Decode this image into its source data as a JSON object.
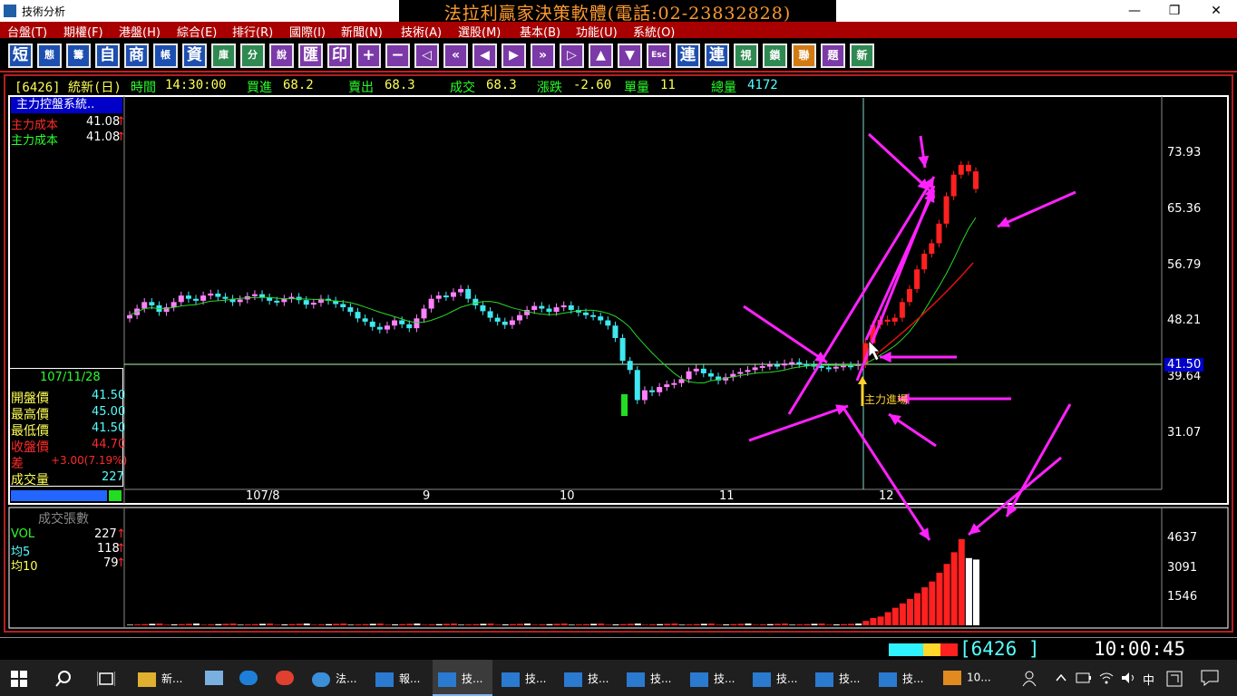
{
  "window": {
    "title": "技術分析",
    "banner": "法拉利贏家決策軟體(電話:02-23832828)"
  },
  "window_controls": {
    "minimize": "—",
    "maximize": "❐",
    "close": "✕"
  },
  "menu": [
    "台盤(T)",
    "期權(F)",
    "港盤(H)",
    "綜合(E)",
    "排行(R)",
    "國際(I)",
    "新聞(N)",
    "技術(A)",
    "選股(M)",
    "基本(B)",
    "功能(U)",
    "系統(O)"
  ],
  "toolbar": [
    "短",
    "態",
    "籌",
    "自",
    "商",
    "帳",
    "資",
    "庫",
    "分",
    "說",
    "匯",
    "印",
    "+",
    "−",
    "◁",
    "«",
    "◀",
    "▶",
    "»",
    "▷",
    "▲",
    "▼",
    "Esc",
    "連",
    "連",
    "視",
    "鎖",
    "聯",
    "題",
    "新"
  ],
  "quote": {
    "symbol": "[6426] 統新(日)",
    "time_label": "時間",
    "time": "14:30:00",
    "bid_label": "買進",
    "bid": "68.2",
    "ask_label": "賣出",
    "ask": "68.3",
    "deal_label": "成交",
    "deal": "68.3",
    "change_label": "漲跌",
    "change": "-2.60",
    "unit_label": "單量",
    "unit": "11",
    "total_label": "總量",
    "total": "4172"
  },
  "indicator_panel": {
    "title": "主力控盤系統..",
    "rows": [
      {
        "label": "主力成本",
        "value": "41.08",
        "arrow": "↑",
        "color": "#ff2a2a"
      },
      {
        "label": "主力成本",
        "value": "41.08",
        "arrow": "↑",
        "color": "#2aff2a"
      }
    ]
  },
  "day_info": {
    "date": "107/11/28",
    "rows": [
      {
        "label": "開盤價",
        "value": "41.50",
        "lcolor": "#ffff55",
        "vcolor": "#55ffff"
      },
      {
        "label": "最高價",
        "value": "45.00",
        "lcolor": "#ffff55",
        "vcolor": "#55ffff"
      },
      {
        "label": "最低價",
        "value": "41.50",
        "lcolor": "#ffff55",
        "vcolor": "#55ffff"
      },
      {
        "label": "收盤價",
        "value": "44.70",
        "lcolor": "#ff2a2a",
        "vcolor": "#ff2a2a"
      },
      {
        "label": "差",
        "value": "+3.00(7.19%)",
        "lcolor": "#ff2a2a",
        "vcolor": "#ff2a2a"
      },
      {
        "label": "成交量",
        "value": "227",
        "lcolor": "#ffff55",
        "vcolor": "#55ffff"
      }
    ]
  },
  "price_axis": [
    "73.93",
    "65.36",
    "56.79",
    "48.21",
    "39.64",
    "31.07"
  ],
  "price_marker": "41.50",
  "date_axis": [
    "107/8",
    "9",
    "10",
    "11",
    "12"
  ],
  "annotation": "主力進場",
  "volume_panel": {
    "title": "成交張數",
    "rows": [
      {
        "label": "VOL",
        "value": "227",
        "arrow": "↑",
        "color": "#2aff2a"
      },
      {
        "label": "均5",
        "value": "118",
        "arrow": "↑",
        "color": "#55ffff"
      },
      {
        "label": "均10",
        "value": "79",
        "arrow": "↑",
        "color": "#ffff55"
      }
    ],
    "axis": [
      "4637",
      "3091",
      "1546"
    ]
  },
  "status": {
    "code": "[6426  ]",
    "clock": "10:00:45"
  },
  "taskbar": {
    "items": [
      {
        "label": "新...",
        "color": "#e0b030"
      },
      {
        "label": "",
        "color": "#7ab0e0"
      },
      {
        "label": "",
        "color": "#1e7fd8"
      },
      {
        "label": "",
        "color": "#e04030"
      },
      {
        "label": "法...",
        "color": "#3a8fd8"
      },
      {
        "label": "報...",
        "color": "#2a7ad0"
      },
      {
        "label": "技...",
        "color": "#2a7ad0"
      },
      {
        "label": "技...",
        "color": "#2a7ad0"
      },
      {
        "label": "技...",
        "color": "#2a7ad0"
      },
      {
        "label": "技...",
        "color": "#2a7ad0"
      },
      {
        "label": "技...",
        "color": "#2a7ad0"
      },
      {
        "label": "技...",
        "color": "#2a7ad0"
      },
      {
        "label": "技...",
        "color": "#2a7ad0"
      },
      {
        "label": "技...",
        "color": "#2a7ad0"
      },
      {
        "label": "10...",
        "color": "#e08a20"
      }
    ],
    "ime": "中"
  },
  "colors": {
    "up": "#ff2020",
    "down": "#3fe8f0",
    "ma": "#27d827",
    "arrow": "#ff22ff"
  }
}
